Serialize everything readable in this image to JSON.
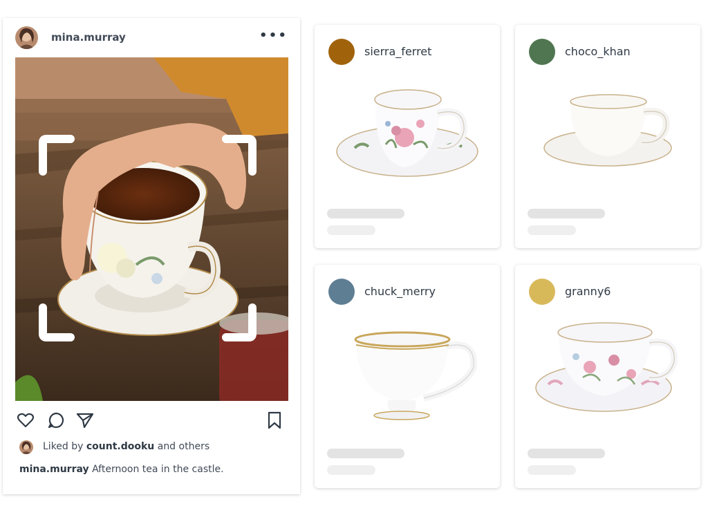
{
  "post": {
    "username": "mina.murray",
    "more_icon": "more-dots-icon",
    "actions": {
      "like_icon": "heart-icon",
      "comment_icon": "comment-icon",
      "share_icon": "send-icon",
      "save_icon": "bookmark-icon"
    },
    "liked_prefix": "Liked by",
    "liked_user": "count.dooku",
    "liked_suffix": "and others",
    "caption_user": "mina.murray",
    "caption_text": "Afternoon tea in the castle."
  },
  "results": [
    {
      "username": "sierra_ferret",
      "color": "#a0630c"
    },
    {
      "username": "choco_khan",
      "color": "#4f7650"
    },
    {
      "username": "chuck_merry",
      "color": "#5e7e93"
    },
    {
      "username": "granny6",
      "color": "#d8b95a"
    }
  ]
}
